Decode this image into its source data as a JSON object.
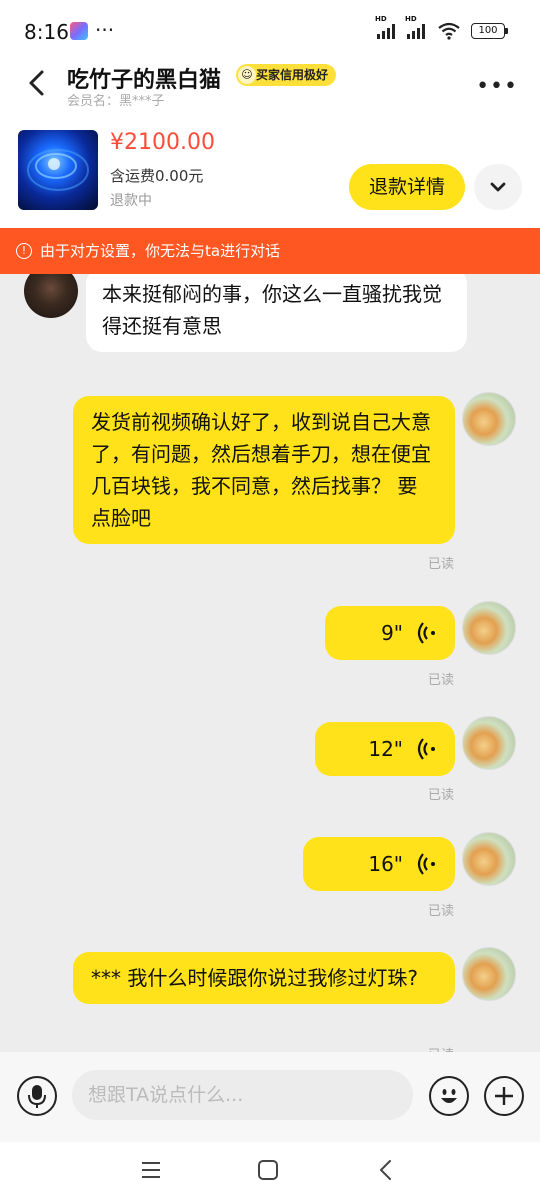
{
  "status_bar": {
    "time": "8:16",
    "more": "···",
    "battery": "100"
  },
  "header": {
    "title": "吃竹子的黑白猫",
    "credit_badge": "买家信用极好",
    "member": "会员名：黑***子"
  },
  "product": {
    "price": "¥2100.00",
    "shipping": "含运费0.00元",
    "status": "退款中",
    "refund_button": "退款详情"
  },
  "warning": {
    "text": "由于对方设置，你无法与ta进行对话"
  },
  "messages": [
    {
      "side": "left",
      "text": "本来挺郁闷的事，你这么一直骚扰我觉得还挺有意思"
    },
    {
      "side": "right",
      "text": "发货前视频确认好了，收到说自己大意了，有问题，然后想着手刀，想在便宜几百块钱，我不同意，然后找事？ 要点脸吧",
      "read": "已读"
    },
    {
      "side": "right",
      "voice_duration": "9\"",
      "read": "已读"
    },
    {
      "side": "right",
      "voice_duration": "12\"",
      "read": "已读"
    },
    {
      "side": "right",
      "voice_duration": "16\"",
      "read": "已读"
    },
    {
      "side": "right",
      "text": "*** 我什么时候跟你说过我修过灯珠?",
      "read": "已读"
    }
  ],
  "input": {
    "placeholder": "想跟TA说点什么..."
  },
  "icons": {
    "back": "chevron-left-icon",
    "more": "more-horizontal-icon",
    "expand": "chevron-down-icon",
    "warning": "alert-circle-icon",
    "voice": "voice-wave-icon",
    "mic": "microphone-icon",
    "emoji": "smile-icon",
    "plus": "plus-icon"
  },
  "colors": {
    "accent": "#ffe21a",
    "warning": "#ff5722",
    "price": "#ff4b3a"
  }
}
